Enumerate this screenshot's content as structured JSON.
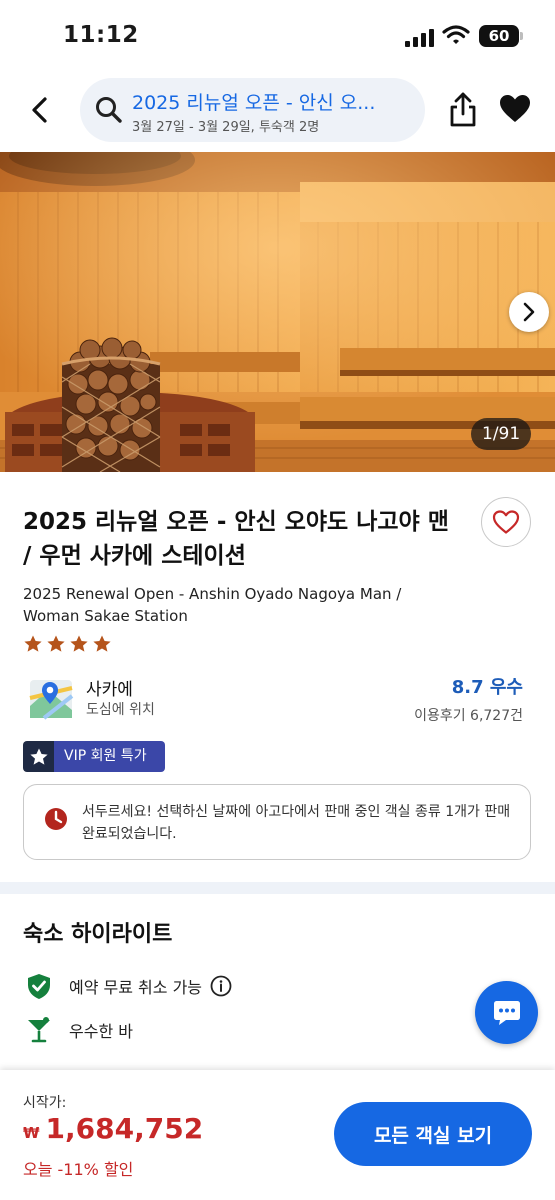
{
  "status_bar": {
    "time": "11:12",
    "battery": "60"
  },
  "header": {
    "search_title": "2025 리뉴얼 오픈 - 안신 오...",
    "search_subtitle": "3월 27일 - 3월 29일, 투숙객 2명"
  },
  "gallery": {
    "counter": "1/91"
  },
  "hotel": {
    "name_ko": "2025 리뉴얼 오픈 - 안신 오야도 나고야 맨 / 우먼 사카에 스테이션",
    "name_en": "2025 Renewal Open - Anshin Oyado Nagoya Man / Woman Sakae Station",
    "star_rating": 4,
    "star_color": "#b5541b"
  },
  "location": {
    "name": "사카에",
    "description": "도심에 위치"
  },
  "rating": {
    "score_text": "8.7 우수",
    "reviews_text": "이용후기 6,727건"
  },
  "vip_badge": {
    "label": "VIP 회원 특가"
  },
  "alert": {
    "text": "서두르세요! 선택하신 날짜에 아고다에서 판매 중인 객실 종류 1개가 판매 완료되었습니다."
  },
  "highlights": {
    "title": "숙소 하이라이트",
    "items": [
      {
        "icon": "shield-check-icon",
        "label": "예약 무료 취소 가능"
      },
      {
        "icon": "cocktail-icon",
        "label": "우수한 바"
      }
    ]
  },
  "bottom_bar": {
    "price_label": "시작가:",
    "currency": "₩",
    "price": "1,684,752",
    "discount_text": "오늘 -11% 할인",
    "cta_label": "모든 객실 보기"
  },
  "colors": {
    "brand_blue": "#1668e3",
    "price_red": "#c62828",
    "vip_purple": "#3b47a8",
    "rating_blue": "#1d5cb8"
  }
}
